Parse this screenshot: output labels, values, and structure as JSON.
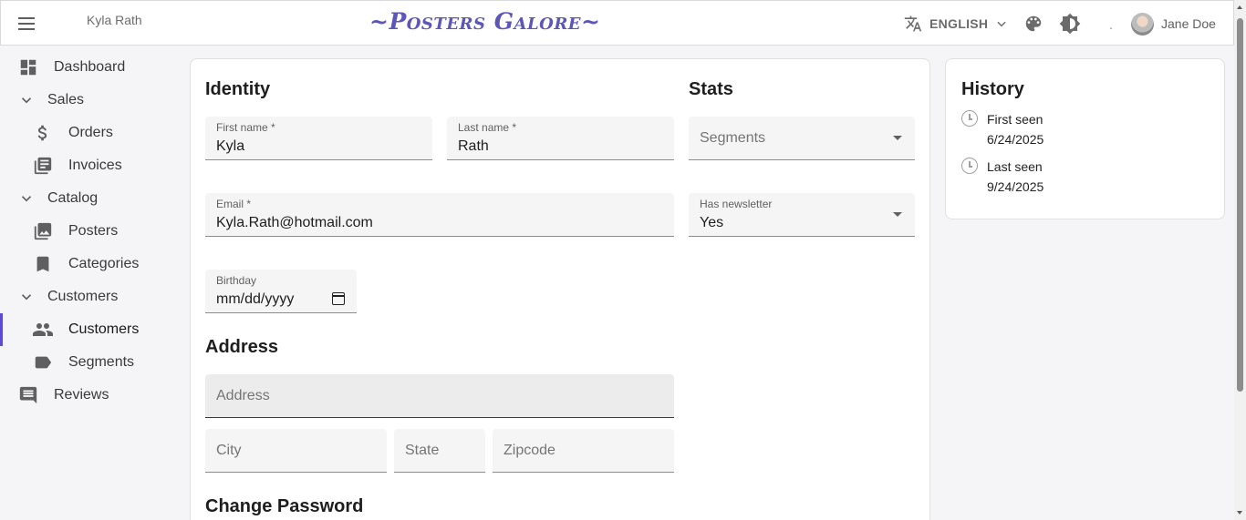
{
  "header": {
    "record_title": "Kyla Rath",
    "brand": "~Posters Galore~",
    "language_label": "ENGLISH",
    "dot": ".",
    "user_name": "Jane Doe"
  },
  "sidebar": {
    "items": [
      {
        "label": "Dashboard",
        "icon": "dashboard-icon"
      },
      {
        "label": "Sales",
        "icon": "chevron-down-icon"
      },
      {
        "label": "Orders",
        "icon": "dollar-icon"
      },
      {
        "label": "Invoices",
        "icon": "invoices-icon"
      },
      {
        "label": "Catalog",
        "icon": "chevron-down-icon"
      },
      {
        "label": "Posters",
        "icon": "image-collection-icon"
      },
      {
        "label": "Categories",
        "icon": "bookmark-icon"
      },
      {
        "label": "Customers",
        "icon": "chevron-down-icon"
      },
      {
        "label": "Customers",
        "icon": "people-icon"
      },
      {
        "label": "Segments",
        "icon": "label-icon"
      },
      {
        "label": "Reviews",
        "icon": "comment-icon"
      }
    ],
    "active_accent": "#5c4bd6"
  },
  "identity": {
    "title": "Identity",
    "first_name_label": "First name *",
    "first_name_value": "Kyla",
    "last_name_label": "Last name *",
    "last_name_value": "Rath",
    "email_label": "Email *",
    "email_value": "Kyla.Rath@hotmail.com",
    "birthday_label": "Birthday",
    "birthday_value": "mm/dd/yyyy"
  },
  "stats": {
    "title": "Stats",
    "segments_placeholder": "Segments",
    "newsletter_label": "Has newsletter",
    "newsletter_value": "Yes"
  },
  "address": {
    "title": "Address",
    "address_placeholder": "Address",
    "city_placeholder": "City",
    "state_placeholder": "State",
    "zipcode_placeholder": "Zipcode"
  },
  "password": {
    "title": "Change Password"
  },
  "history": {
    "title": "History",
    "first_seen_label": "First seen",
    "first_seen_value": "6/24/2025",
    "last_seen_label": "Last seen",
    "last_seen_value": "9/24/2025"
  },
  "colors": {
    "brand": "#5c56b8",
    "background": "#f5f5f8"
  }
}
